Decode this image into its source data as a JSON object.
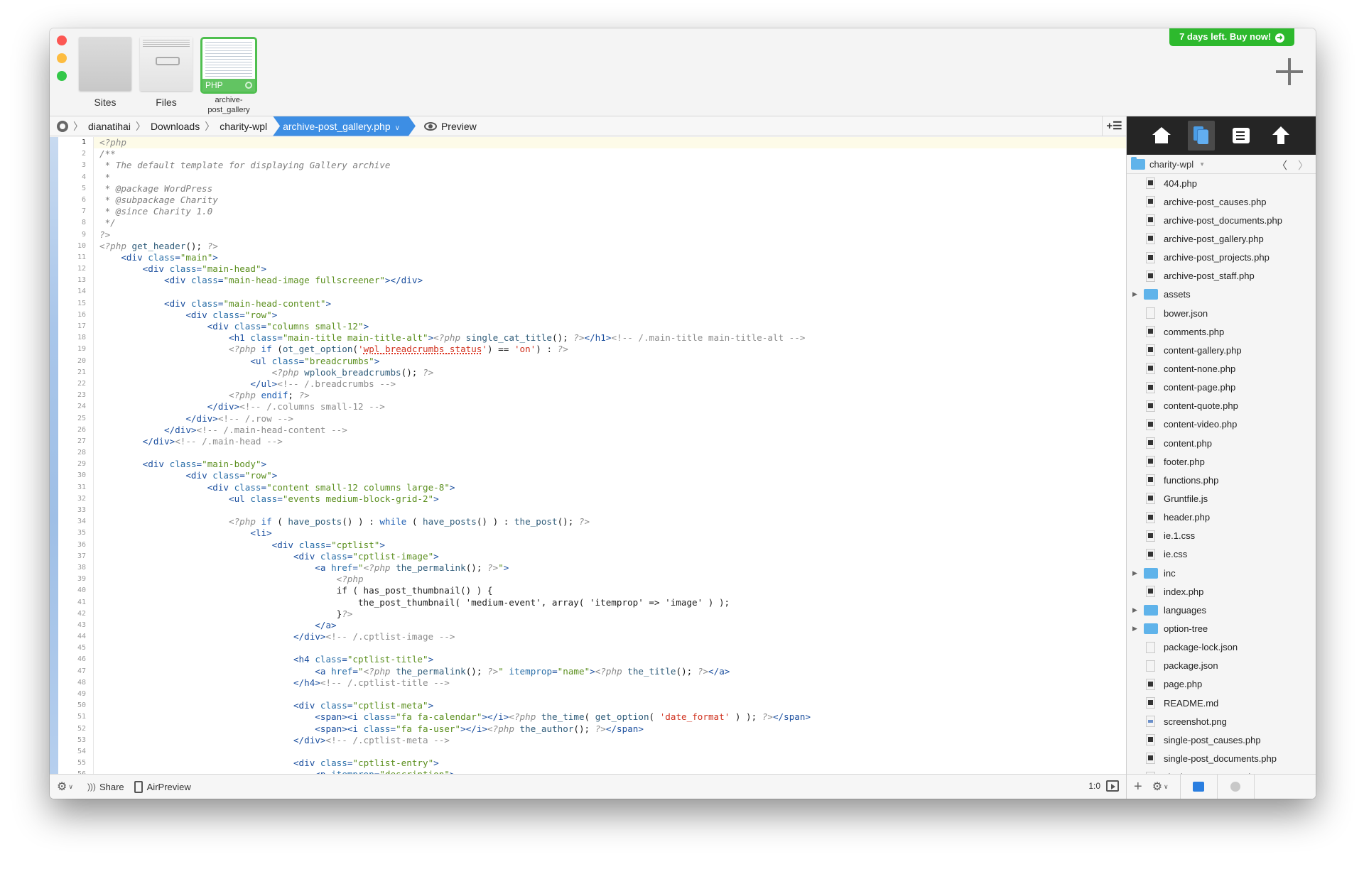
{
  "thumbnails": [
    {
      "label": "Sites"
    },
    {
      "label": "Files"
    },
    {
      "label": "archive-\npost_gallery",
      "badge": "PHP"
    }
  ],
  "trial_banner": "7 days left. Buy now!",
  "breadcrumb": {
    "items": [
      "dianatihai",
      "Downloads",
      "charity-wpl"
    ],
    "active": "archive-post_gallery.php",
    "preview_label": "Preview"
  },
  "editor": {
    "line_numbers": [
      "1",
      "2",
      "3",
      "4",
      "5",
      "6",
      "7",
      "8",
      "9",
      "10",
      "11",
      "12",
      "13",
      "14",
      "15",
      "16",
      "17",
      "18",
      "19",
      "20",
      "21",
      "22",
      "23",
      "24",
      "25",
      "26",
      "27",
      "28",
      "29",
      "30",
      "31",
      "32",
      "33",
      "34",
      "35",
      "36",
      "37",
      "38",
      "39",
      "40",
      "41",
      "42",
      "43",
      "44",
      "45",
      "46",
      "47",
      "48",
      "49",
      "50",
      "51",
      "52",
      "53",
      "54",
      "55",
      "56"
    ],
    "lines": [
      "<?php",
      "/**",
      " * The default template for displaying Gallery archive",
      " *",
      " * @package WordPress",
      " * @subpackage Charity",
      " * @since Charity 1.0",
      " */",
      "?>",
      "<?php get_header(); ?>",
      "    <div class=\"main\">",
      "        <div class=\"main-head\">",
      "            <div class=\"main-head-image fullscreener\"></div>",
      "",
      "            <div class=\"main-head-content\">",
      "                <div class=\"row\">",
      "                    <div class=\"columns small-12\">",
      "                        <h1 class=\"main-title main-title-alt\"><?php single_cat_title(); ?></h1><!-- /.main-title main-title-alt -->",
      "                        <?php if (ot_get_option('wpl_breadcrumbs_status') == 'on') : ?>",
      "                            <ul class=\"breadcrumbs\">",
      "                                <?php wplook_breadcrumbs(); ?>",
      "                            </ul><!-- /.breadcrumbs -->",
      "                        <?php endif; ?>",
      "                    </div><!-- /.columns small-12 -->",
      "                </div><!-- /.row -->",
      "            </div><!-- /.main-head-content -->",
      "        </div><!-- /.main-head -->",
      "",
      "        <div class=\"main-body\">",
      "                <div class=\"row\">",
      "                    <div class=\"content small-12 columns large-8\">",
      "                        <ul class=\"events medium-block-grid-2\">",
      "",
      "                        <?php if ( have_posts() ) : while ( have_posts() ) : the_post(); ?>",
      "                            <li>",
      "                                <div class=\"cptlist\">",
      "                                    <div class=\"cptlist-image\">",
      "                                        <a href=\"<?php the_permalink(); ?>\">",
      "                                            <?php",
      "                                            if ( has_post_thumbnail() ) {",
      "                                                the_post_thumbnail( 'medium-event', array( 'itemprop' => 'image' ) );",
      "                                            }?>",
      "                                        </a>",
      "                                    </div><!-- /.cptlist-image -->",
      "",
      "                                    <h4 class=\"cptlist-title\">",
      "                                        <a href=\"<?php the_permalink(); ?>\" itemprop=\"name\"><?php the_title(); ?></a>",
      "                                    </h4><!-- /.cptlist-title -->",
      "",
      "                                    <div class=\"cptlist-meta\">",
      "                                        <span><i class=\"fa fa-calendar\"></i><?php the_time( get_option( 'date_format' ) ); ?></span>",
      "                                        <span><i class=\"fa fa-user\"></i><?php the_author(); ?></span>",
      "                                    </div><!-- /.cptlist-meta -->",
      "",
      "                                    <div class=\"cptlist-entry\">",
      "                                        <p itemprop=\"description\">"
    ]
  },
  "status_bar": {
    "share_label": "Share",
    "airpreview_label": "AirPreview",
    "cursor_position": "1:0"
  },
  "sidebar": {
    "current_folder": "charity-wpl",
    "files": [
      {
        "name": "404.php",
        "type": "php"
      },
      {
        "name": "archive-post_causes.php",
        "type": "php"
      },
      {
        "name": "archive-post_documents.php",
        "type": "php"
      },
      {
        "name": "archive-post_gallery.php",
        "type": "php"
      },
      {
        "name": "archive-post_projects.php",
        "type": "php"
      },
      {
        "name": "archive-post_staff.php",
        "type": "php"
      },
      {
        "name": "assets",
        "type": "folder"
      },
      {
        "name": "bower.json",
        "type": "blank"
      },
      {
        "name": "comments.php",
        "type": "php"
      },
      {
        "name": "content-gallery.php",
        "type": "php"
      },
      {
        "name": "content-none.php",
        "type": "php"
      },
      {
        "name": "content-page.php",
        "type": "php"
      },
      {
        "name": "content-quote.php",
        "type": "php"
      },
      {
        "name": "content-video.php",
        "type": "php"
      },
      {
        "name": "content.php",
        "type": "php"
      },
      {
        "name": "footer.php",
        "type": "php"
      },
      {
        "name": "functions.php",
        "type": "php"
      },
      {
        "name": "Gruntfile.js",
        "type": "php"
      },
      {
        "name": "header.php",
        "type": "php"
      },
      {
        "name": "ie.1.css",
        "type": "php"
      },
      {
        "name": "ie.css",
        "type": "php"
      },
      {
        "name": "inc",
        "type": "folder"
      },
      {
        "name": "index.php",
        "type": "php"
      },
      {
        "name": "languages",
        "type": "folder"
      },
      {
        "name": "option-tree",
        "type": "folder"
      },
      {
        "name": "package-lock.json",
        "type": "blank"
      },
      {
        "name": "package.json",
        "type": "blank"
      },
      {
        "name": "page.php",
        "type": "php"
      },
      {
        "name": "README.md",
        "type": "php"
      },
      {
        "name": "screenshot.png",
        "type": "img"
      },
      {
        "name": "single-post_causes.php",
        "type": "php"
      },
      {
        "name": "single-post_documents.php",
        "type": "php"
      },
      {
        "name": "single-post_events.php",
        "type": "php"
      }
    ]
  },
  "colors": {
    "accent": "#3d8ee4",
    "trial_green": "#2db92d",
    "php_green": "#4fbf4f"
  }
}
